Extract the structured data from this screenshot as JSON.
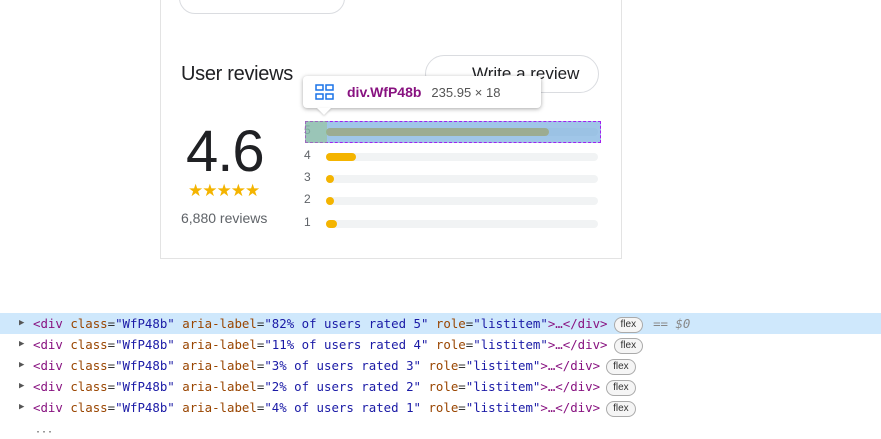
{
  "reviews": {
    "title": "User reviews",
    "write_label": "Write a review",
    "rating": "4.6",
    "stars": "★★★★★",
    "count_label": "6,880 reviews",
    "bars": [
      {
        "label": "5",
        "percent": 82
      },
      {
        "label": "4",
        "percent": 11
      },
      {
        "label": "3",
        "percent": 3
      },
      {
        "label": "2",
        "percent": 2
      },
      {
        "label": "1",
        "percent": 4
      }
    ]
  },
  "inspector": {
    "element_name": "div.WfP48b",
    "element_size": "235.95 × 18"
  },
  "devtools": {
    "rows": [
      {
        "tag_open": "<div",
        "attr1": "class",
        "val1": "\"WfP48b\"",
        "attr2": "aria-label",
        "val2": "\"82% of users rated 5\"",
        "attr3": "role",
        "val3": "\"listitem\"",
        "tail": ">…</div>",
        "badge": "flex",
        "dollar": "== $0"
      },
      {
        "tag_open": "<div",
        "attr1": "class",
        "val1": "\"WfP48b\"",
        "attr2": "aria-label",
        "val2": "\"11% of users rated 4\"",
        "attr3": "role",
        "val3": "\"listitem\"",
        "tail": ">…</div>",
        "badge": "flex",
        "dollar": ""
      },
      {
        "tag_open": "<div",
        "attr1": "class",
        "val1": "\"WfP48b\"",
        "attr2": "aria-label",
        "val2": "\"3% of users rated 3\"",
        "attr3": "role",
        "val3": "\"listitem\"",
        "tail": ">…</div>",
        "badge": "flex",
        "dollar": ""
      },
      {
        "tag_open": "<div",
        "attr1": "class",
        "val1": "\"WfP48b\"",
        "attr2": "aria-label",
        "val2": "\"2% of users rated 2\"",
        "attr3": "role",
        "val3": "\"listitem\"",
        "tail": ">…</div>",
        "badge": "flex",
        "dollar": ""
      },
      {
        "tag_open": "<div",
        "attr1": "class",
        "val1": "\"WfP48b\"",
        "attr2": "aria-label",
        "val2": "\"4% of users rated 1\"",
        "attr3": "role",
        "val3": "\"listitem\"",
        "tail": ">…</div>",
        "badge": "flex",
        "dollar": ""
      }
    ]
  },
  "colors": {
    "star": "#f4b400",
    "highlight": "#a020f0",
    "selected_row": "#cfe8fc"
  }
}
